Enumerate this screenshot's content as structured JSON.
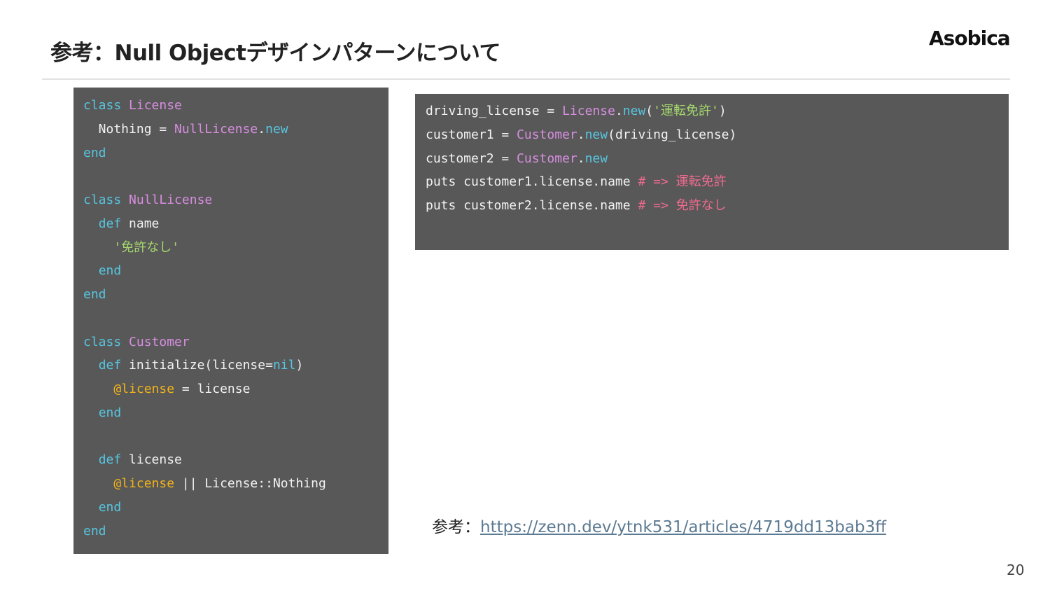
{
  "slide": {
    "title": "参考：Null Objectデザインパターンについて",
    "logo": "Asobica",
    "page_number": "20"
  },
  "left_code": {
    "lines": [
      [
        {
          "t": "class",
          "c": "kw"
        },
        {
          "t": " "
        },
        {
          "t": "License",
          "c": "cls"
        }
      ],
      [
        {
          "t": "  Nothing = "
        },
        {
          "t": "NullLicense",
          "c": "cls"
        },
        {
          "t": "."
        },
        {
          "t": "new",
          "c": "kw"
        }
      ],
      [
        {
          "t": "end",
          "c": "kw"
        }
      ],
      [],
      [
        {
          "t": "class",
          "c": "kw"
        },
        {
          "t": " "
        },
        {
          "t": "NullLicense",
          "c": "cls"
        }
      ],
      [
        {
          "t": "  "
        },
        {
          "t": "def",
          "c": "kw"
        },
        {
          "t": " name"
        }
      ],
      [
        {
          "t": "    "
        },
        {
          "t": "'免許なし'",
          "c": "str"
        }
      ],
      [
        {
          "t": "  "
        },
        {
          "t": "end",
          "c": "kw"
        }
      ],
      [
        {
          "t": "end",
          "c": "kw"
        }
      ],
      [],
      [
        {
          "t": "class",
          "c": "kw"
        },
        {
          "t": " "
        },
        {
          "t": "Customer",
          "c": "cls"
        }
      ],
      [
        {
          "t": "  "
        },
        {
          "t": "def",
          "c": "kw"
        },
        {
          "t": " initialize(license="
        },
        {
          "t": "nil",
          "c": "kw"
        },
        {
          "t": ")"
        }
      ],
      [
        {
          "t": "    "
        },
        {
          "t": "@license",
          "c": "ivar"
        },
        {
          "t": " = license"
        }
      ],
      [
        {
          "t": "  "
        },
        {
          "t": "end",
          "c": "kw"
        }
      ],
      [],
      [
        {
          "t": "  "
        },
        {
          "t": "def",
          "c": "kw"
        },
        {
          "t": " license"
        }
      ],
      [
        {
          "t": "    "
        },
        {
          "t": "@license",
          "c": "ivar"
        },
        {
          "t": " || License::Nothing"
        }
      ],
      [
        {
          "t": "  "
        },
        {
          "t": "end",
          "c": "kw"
        }
      ],
      [
        {
          "t": "end",
          "c": "kw"
        }
      ]
    ]
  },
  "right_code": {
    "lines": [
      [
        {
          "t": "driving_license = "
        },
        {
          "t": "License",
          "c": "cls"
        },
        {
          "t": "."
        },
        {
          "t": "new",
          "c": "kw"
        },
        {
          "t": "("
        },
        {
          "t": "'運転免許'",
          "c": "str"
        },
        {
          "t": ")"
        }
      ],
      [
        {
          "t": "customer1 = "
        },
        {
          "t": "Customer",
          "c": "cls"
        },
        {
          "t": "."
        },
        {
          "t": "new",
          "c": "kw"
        },
        {
          "t": "(driving_license)"
        }
      ],
      [
        {
          "t": "customer2 = "
        },
        {
          "t": "Customer",
          "c": "cls"
        },
        {
          "t": "."
        },
        {
          "t": "new",
          "c": "kw"
        }
      ],
      [
        {
          "t": "puts customer1.license.name "
        },
        {
          "t": "# => 運転免許",
          "c": "cmt"
        }
      ],
      [
        {
          "t": "puts customer2.license.name "
        },
        {
          "t": "# => 免許なし",
          "c": "cmt"
        }
      ]
    ]
  },
  "reference": {
    "label": "参考：",
    "url_text": "https://zenn.dev/ytnk531/articles/4719dd13bab3ff"
  },
  "colors": {
    "code_bg": "#585858",
    "keyword": "#56c6e0",
    "class_name": "#d78ee0",
    "string": "#a5d86d",
    "ivar": "#f2b31a",
    "comment": "#ef6b8f",
    "link": "#5c7a92"
  }
}
